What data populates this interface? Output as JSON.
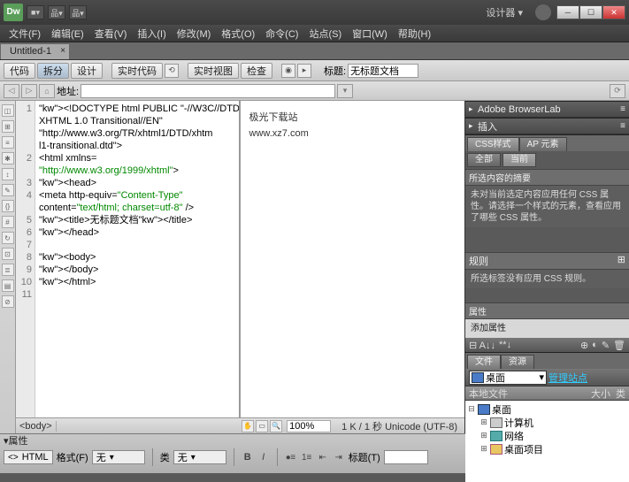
{
  "titlebar": {
    "logo": "Dw",
    "workspace": "设计器",
    "dropdown_items": [
      "■▾",
      "品▾",
      "品▾"
    ]
  },
  "menu": {
    "items": [
      "文件(F)",
      "编辑(E)",
      "查看(V)",
      "插入(I)",
      "修改(M)",
      "格式(O)",
      "命令(C)",
      "站点(S)",
      "窗口(W)",
      "帮助(H)"
    ]
  },
  "tabs": {
    "active": "Untitled-1"
  },
  "viewbar": {
    "code": "代码",
    "split": "拆分",
    "design": "设计",
    "live_code": "实时代码",
    "live_view": "实时视图",
    "inspect": "检查",
    "title_label": "标题:",
    "title_value": "无标题文档"
  },
  "addrbar": {
    "label": "地址:"
  },
  "code_lines": [
    "<!DOCTYPE html PUBLIC \"-//W3C//DTD",
    "XHTML 1.0 Transitional//EN\"",
    "\"http://www.w3.org/TR/xhtml1/DTD/xhtm",
    "l1-transitional.dtd\">",
    "<html xmlns=",
    "\"http://www.w3.org/1999/xhtml\">",
    "<head>",
    "<meta http-equiv=\"Content-Type\"",
    "content=\"text/html; charset=utf-8\" />",
    "<title>无标题文档</title>",
    "</head>",
    "",
    "<body>",
    "</body>",
    "</html>"
  ],
  "gutter": [
    "1",
    "",
    "",
    "",
    "2",
    "",
    "3",
    "4",
    "",
    "5",
    "6",
    "7",
    "8",
    "9",
    "10",
    "11"
  ],
  "preview": {
    "line1": "极光下载站",
    "line2": "www.xz7.com"
  },
  "statusbar": {
    "tag": "<body>",
    "zoom": "100%",
    "info": "1 K / 1 秒 Unicode (UTF-8)"
  },
  "panels": {
    "browserlab": "Adobe BrowserLab",
    "insert": "插入",
    "css": {
      "tab1": "CSS样式",
      "tab2": "AP 元素",
      "btn_all": "全部",
      "btn_current": "当前",
      "summary_label": "所选内容的摘要",
      "summary_text": "未对当前选定内容应用任何 CSS 属性。请选择一个样式的元素，查看应用了哪些 CSS 属性。",
      "rules_label": "规则",
      "rules_text": "所选标签没有应用 CSS 规则。",
      "props_label": "属性",
      "props_placeholder": "添加属性"
    },
    "files": {
      "tab1": "文件",
      "tab2": "资源",
      "location": "桌面",
      "manage": "管理站点",
      "col1": "本地文件",
      "col2": "大小",
      "col3": "类",
      "tree": {
        "root": "桌面",
        "computer": "计算机",
        "network": "网络",
        "desktop_items": "桌面项目"
      }
    }
  },
  "properties": {
    "header": "属性",
    "mode": "HTML",
    "format_label": "格式(F)",
    "format_value": "无",
    "class_label": "类",
    "class_value": "无",
    "title_label": "标题(T)"
  }
}
